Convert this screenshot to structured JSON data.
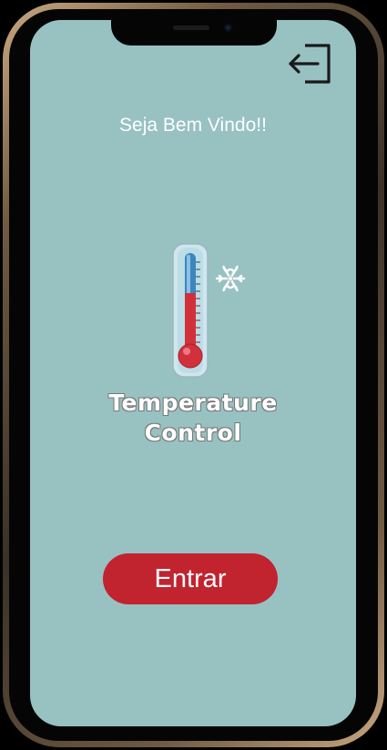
{
  "colors": {
    "screen_background": "#98c1c2",
    "accent_red": "#c1232f",
    "text": "#ffffff",
    "icon_dark": "#1a1a1a"
  },
  "header": {
    "logout_icon": "logout-icon"
  },
  "welcome_text": "Seja Bem Vindo!!",
  "logo": {
    "icon": "thermometer-icon",
    "snowflake_icon": "snowflake-icon",
    "title_line1": "Temperature",
    "title_line2": "Control"
  },
  "enter_button_label": "Entrar"
}
